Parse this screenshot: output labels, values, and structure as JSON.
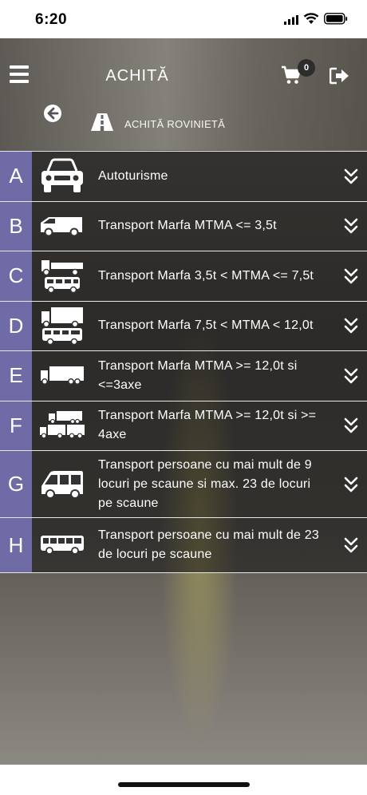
{
  "status_bar": {
    "time": "6:20",
    "icons": [
      "signal-icon",
      "wifi-icon",
      "battery-icon"
    ]
  },
  "header": {
    "title": "ACHITĂ",
    "cart_count": "0",
    "breadcrumb": "ACHITĂ ROVINIETĂ",
    "icons": [
      "menu-icon",
      "cart-icon",
      "logout-icon",
      "back-icon",
      "road-icon"
    ]
  },
  "colors": {
    "letter_bg": "#6f6ba6",
    "row_bg": "rgba(20,20,20,0.55)",
    "divider": "#e8e8e8"
  },
  "categories": [
    {
      "letter": "A",
      "label": "Autoturisme",
      "icon": "car-icon"
    },
    {
      "letter": "B",
      "label": "Transport Marfa MTMA <= 3,5t",
      "icon": "van-icon"
    },
    {
      "letter": "C",
      "label": "Transport Marfa 3,5t < MTMA <= 7,5t",
      "icon": "truck-small-icon"
    },
    {
      "letter": "D",
      "label": "Transport Marfa 7,5t < MTMA < 12,0t",
      "icon": "truck-medium-icon"
    },
    {
      "letter": "E",
      "label": "Transport Marfa MTMA >= 12,0t si <=3axe",
      "icon": "truck-large-icon"
    },
    {
      "letter": "F",
      "label": "Transport Marfa MTMA >= 12,0t si >= 4axe",
      "icon": "truck-trailer-icon"
    },
    {
      "letter": "G",
      "label": "Transport persoane cu mai mult de 9 locuri pe scaune si max. 23 de locuri pe scaune",
      "icon": "minibus-icon"
    },
    {
      "letter": "H",
      "label": "Transport persoane cu mai mult de 23 de locuri pe scaune",
      "icon": "bus-icon"
    }
  ]
}
